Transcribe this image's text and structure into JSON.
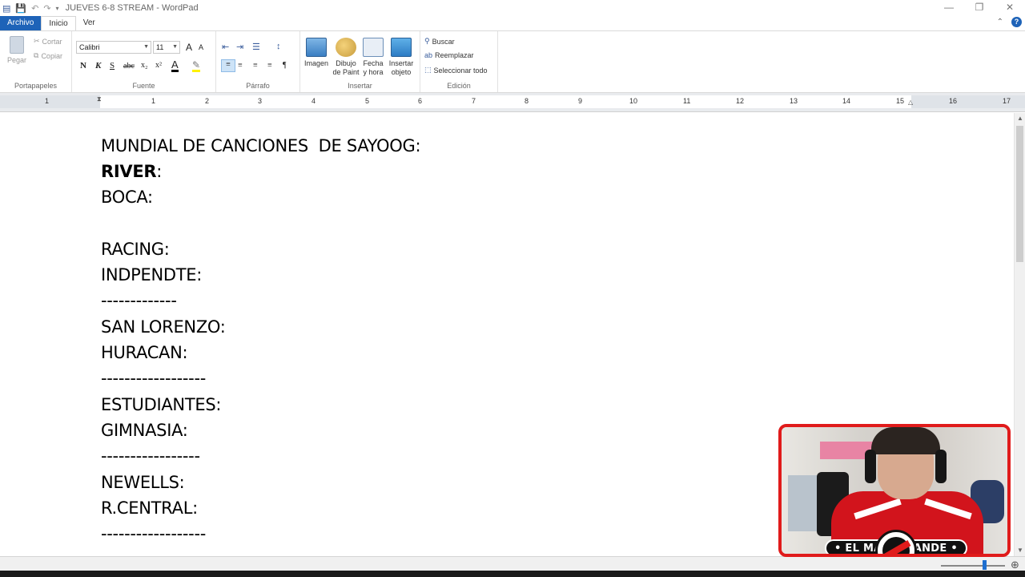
{
  "window": {
    "title": "JUEVES 6-8 STREAM - WordPad",
    "controls": {
      "minimize": "—",
      "maximize": "❐",
      "close": "✕"
    }
  },
  "quick_access": {
    "icons": [
      "wordpad-app-icon",
      "save-icon",
      "undo-icon",
      "redo-icon",
      "customize-qat-icon"
    ]
  },
  "tabs": [
    {
      "label": "Archivo"
    },
    {
      "label": "Inicio"
    },
    {
      "label": "Ver"
    }
  ],
  "ribbon": {
    "portapapeles": {
      "label": "Portapapeles",
      "pegar": "Pegar",
      "cortar": "Cortar",
      "copiar": "Copiar"
    },
    "fuente": {
      "label": "Fuente",
      "font_name": "Calibri",
      "font_size": "11",
      "grow": "A",
      "shrink": "A",
      "bold": "N",
      "italic": "K",
      "underline": "S",
      "strike": "abc",
      "subscript": "x₂",
      "superscript": "x²",
      "font_color": "A"
    },
    "parrafo": {
      "label": "Párrafo"
    },
    "insertar": {
      "label": "Insertar",
      "imagen": "Imagen",
      "dibujo_1": "Dibujo",
      "dibujo_2": "de Paint",
      "fecha_1": "Fecha",
      "fecha_2": "y hora",
      "objeto_1": "Insertar",
      "objeto_2": "objeto"
    },
    "edicion": {
      "label": "Edición",
      "buscar": "Buscar",
      "reemplazar": "Reemplazar",
      "seleccionar": "Seleccionar todo"
    }
  },
  "ruler": {
    "numbers": [
      "1",
      "1",
      "2",
      "3",
      "4",
      "5",
      "6",
      "7",
      "8",
      "9",
      "10",
      "11",
      "12",
      "13",
      "14",
      "15",
      "16",
      "17"
    ]
  },
  "document": {
    "lines": [
      {
        "text": "MUNDIAL DE CANCIONES  DE SAYOOG:",
        "bold": false
      },
      {
        "text": "RIVER",
        "bold": true,
        "suffix": ":"
      },
      {
        "text": "BOCA:",
        "bold": false
      },
      {
        "text": "",
        "bold": false
      },
      {
        "text": "RACING:",
        "bold": false
      },
      {
        "text": "INDPENDTE:",
        "bold": false
      },
      {
        "text": "-------------",
        "bold": false
      },
      {
        "text": "SAN LORENZO:",
        "bold": false
      },
      {
        "text": "HURACAN:",
        "bold": false
      },
      {
        "text": "------------------",
        "bold": false
      },
      {
        "text": "ESTUDIANTES:",
        "bold": false
      },
      {
        "text": "GIMNASIA:",
        "bold": false
      },
      {
        "text": "-----------------",
        "bold": false
      },
      {
        "text": "NEWELLS:",
        "bold": false
      },
      {
        "text": "R.CENTRAL:",
        "bold": false
      },
      {
        "text": "------------------",
        "bold": false
      }
    ]
  },
  "webcam_overlay": {
    "banner_left": "• EL MÁS",
    "banner_right": "GRANDE •",
    "accent_color": "#e01b1b"
  },
  "colors": {
    "file_tab": "#1e63b8",
    "ruler_margin": "#dfe3e8"
  }
}
